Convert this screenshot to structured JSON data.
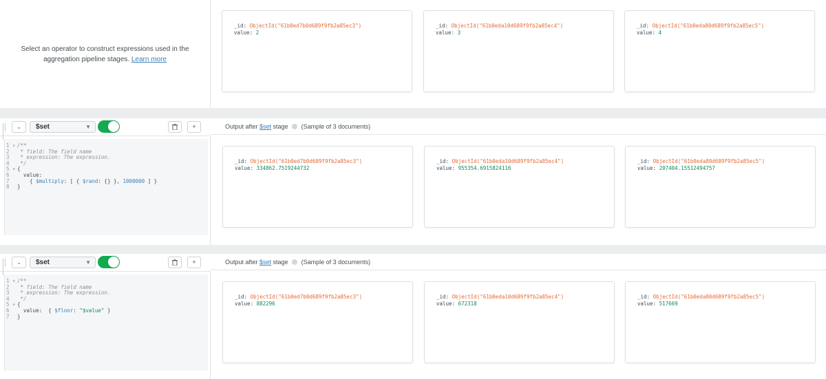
{
  "stage0": {
    "hint_text": "Select an operator to construct expressions used in the aggregation pipeline stages.",
    "learn_more": "Learn more",
    "docs": [
      {
        "id_key": "_id:",
        "oid": "ObjectId(\"61b0ed7b0d689f9fb2a85ec3\")",
        "value_key": "value:",
        "value": "2"
      },
      {
        "id_key": "_id:",
        "oid": "ObjectId(\"61b0eda10d689f9fb2a85ec4\")",
        "value_key": "value:",
        "value": "3"
      },
      {
        "id_key": "_id:",
        "oid": "ObjectId(\"61b0eda80d689f9fb2a85ec5\")",
        "value_key": "value:",
        "value": "4"
      }
    ]
  },
  "stage1": {
    "operator": "$set",
    "collapse_glyph": "⌄",
    "delete_glyph": "🗑",
    "add_glyph": "+",
    "output_prefix": "Output after ",
    "output_link": "$set",
    "output_mid": " stage ",
    "output_suffix": " (Sample of 3 documents)",
    "code": {
      "l1": "/**",
      "l2": " * field: The field name",
      "l3": " * expression: The expression.",
      "l4": " */",
      "l5": "{",
      "l6": "  value:",
      "l7a": "    { ",
      "l7op": "$multiply",
      "l7b": ": [ { ",
      "l7op2": "$rand",
      "l7c": ": {} }, ",
      "l7num": "1000000",
      "l7d": " ] }",
      "l8": "}"
    },
    "docs": [
      {
        "id_key": "_id:",
        "oid": "ObjectId(\"61b0ed7b0d689f9fb2a85ec3\")",
        "value_key": "value:",
        "value": "334862.7519244732"
      },
      {
        "id_key": "_id:",
        "oid": "ObjectId(\"61b0eda10d689f9fb2a85ec4\")",
        "value_key": "value:",
        "value": "955354.6915824116"
      },
      {
        "id_key": "_id:",
        "oid": "ObjectId(\"61b0eda80d689f9fb2a85ec5\")",
        "value_key": "value:",
        "value": "207404.15512494757"
      }
    ]
  },
  "stage2": {
    "operator": "$set",
    "collapse_glyph": "⌄",
    "delete_glyph": "🗑",
    "add_glyph": "+",
    "output_prefix": "Output after ",
    "output_link": "$set",
    "output_mid": " stage ",
    "output_suffix": " (Sample of 3 documents)",
    "code": {
      "l1": "/**",
      "l2": " * field: The field name",
      "l3": " * expression: The expression.",
      "l4": " */",
      "l5": "{",
      "l6a": "  value:  { ",
      "l6op": "$floor",
      "l6b": ": ",
      "l6str": "\"$value\"",
      "l6c": " }",
      "l7": "}"
    },
    "docs": [
      {
        "id_key": "_id:",
        "oid": "ObjectId(\"61b0ed7b0d689f9fb2a85ec3\")",
        "value_key": "value:",
        "value": "882296"
      },
      {
        "id_key": "_id:",
        "oid": "ObjectId(\"61b0eda10d689f9fb2a85ec4\")",
        "value_key": "value:",
        "value": "672318"
      },
      {
        "id_key": "_id:",
        "oid": "ObjectId(\"61b0eda80d689f9fb2a85ec5\")",
        "value_key": "value:",
        "value": "517669"
      }
    ]
  },
  "colors": {
    "accent": "#13aa52",
    "link": "#3c7fb5",
    "objectid": "#e46a34",
    "number": "#12885b"
  }
}
